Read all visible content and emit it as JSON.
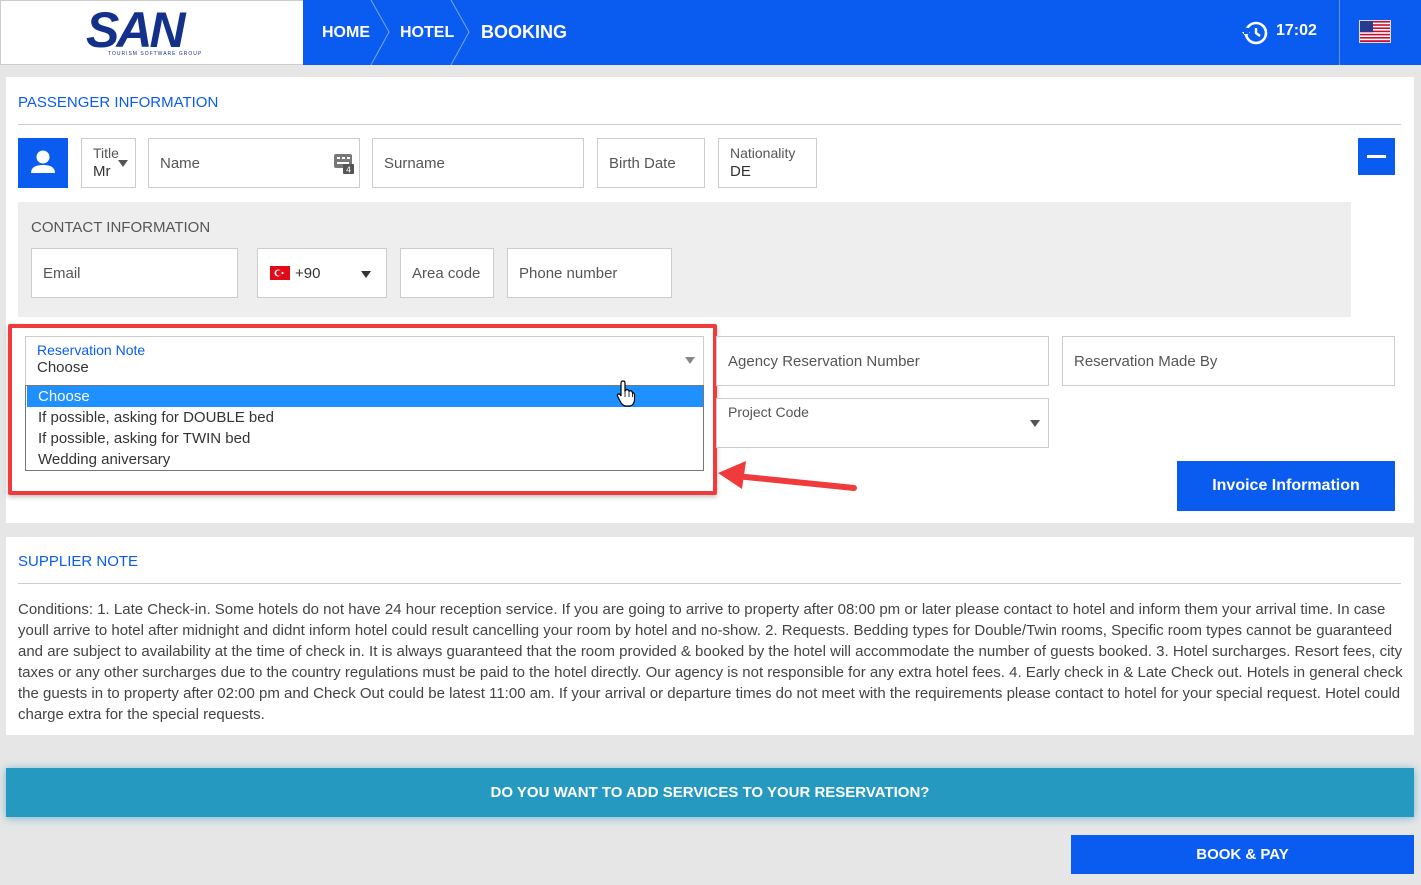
{
  "header": {
    "logo": "SAN",
    "logo_sub": "TOURISM SOFTWARE GROUP",
    "breadcrumb": [
      "HOME",
      "HOTEL",
      "BOOKING"
    ],
    "time": "17:02",
    "icons": {
      "clock": "history-icon",
      "flag": "us-flag-icon"
    },
    "brand_color": "#0a5cf0"
  },
  "passenger": {
    "section_title": "PASSENGER INFORMATION",
    "title_label": "Title",
    "title_value": "Mr",
    "name_placeholder": "Name",
    "surname_placeholder": "Surname",
    "birthdate_placeholder": "Birth Date",
    "nationality_label": "Nationality",
    "nationality_value": "DE"
  },
  "contact": {
    "section_title": "CONTACT INFORMATION",
    "email_placeholder": "Email",
    "country_code": "+90",
    "area_code_placeholder": "Area code",
    "phone_placeholder": "Phone number"
  },
  "reservation": {
    "note_label": "Reservation Note",
    "note_value": "Choose",
    "note_options": [
      "Choose",
      "If possible, asking for DOUBLE bed",
      "If possible, asking for TWIN bed",
      "Wedding aniversary"
    ],
    "agency_number_placeholder": "Agency Reservation Number",
    "made_by_placeholder": "Reservation Made By",
    "project_code_label": "Project Code",
    "invoice_button": "Invoice Information"
  },
  "supplier": {
    "section_title": "SUPPLIER NOTE",
    "conditions": "Conditions: 1. Late Check-in. Some hotels do not have 24 hour reception service. If you are going to arrive to property after 08:00 pm or later please contact to hotel and inform them your arrival time. In case youll arrive to hotel after midnight and didnt inform hotel could result cancelling your room by hotel and no-show. 2. Requests. Bedding types for Double/Twin rooms, Specific room types cannot be guaranteed and are subject to availability at the time of check in. It is always guaranteed that the room provided & booked by the hotel will accommodate the number of guests booked. 3. Hotel surcharges. Resort fees, city taxes or any other surcharges due to the country regulations must be paid to the hotel directly. Our agency is not responsible for any extra hotel fees. 4. Early check in & Late Check out. Hotels in general check the guests in to property after 02:00 pm and Check Out could be latest 11:00 am. If your arrival or departure times do not meet with the requirements please contact to hotel for your special request. Hotel could charge extra for the special requests."
  },
  "actions": {
    "add_services": "DO YOU WANT TO ADD SERVICES TO YOUR RESERVATION?",
    "book_pay": "BOOK & PAY"
  },
  "colors": {
    "highlight_box": "#ef3b3b",
    "services_bar": "#2699c0",
    "selected_option": "#1e90ff"
  }
}
